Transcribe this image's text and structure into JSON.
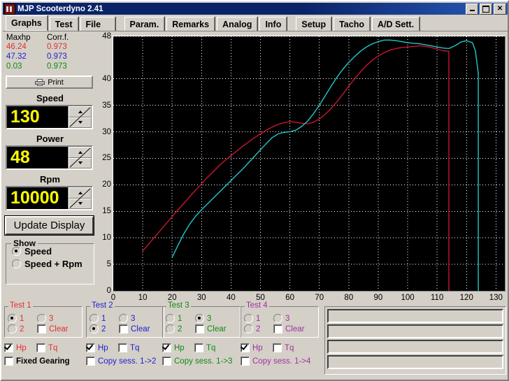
{
  "window": {
    "title": "MJP Scooterdyno 2.41",
    "icon": "app-icon",
    "buttons": {
      "minimize": "_",
      "maximize": "□",
      "close": "✕"
    }
  },
  "tabs": [
    {
      "label": "Graphs",
      "active": true
    },
    {
      "label": "Test",
      "active": false
    },
    {
      "label": "File",
      "active": false
    },
    {
      "label": "Param.",
      "active": false
    },
    {
      "label": "Remarks",
      "active": false
    },
    {
      "label": "Analog",
      "active": false
    },
    {
      "label": "Info",
      "active": false
    },
    {
      "label": "Setup",
      "active": false
    },
    {
      "label": "Tacho",
      "active": false
    },
    {
      "label": "A/D Sett.",
      "active": false
    }
  ],
  "results": {
    "header_maxhp": "Maxhp",
    "header_corrf": "Corr.f.",
    "rows": [
      {
        "maxhp": "46.24",
        "corrf": "0.973",
        "color": "#e03030"
      },
      {
        "maxhp": "47.32",
        "corrf": "0.973",
        "color": "#2020d0"
      },
      {
        "maxhp": "0.03",
        "corrf": "0.973",
        "color": "#108a10"
      }
    ]
  },
  "print_button": "Print",
  "fields": [
    {
      "label": "Speed",
      "value": "130"
    },
    {
      "label": "Power",
      "value": "48"
    },
    {
      "label": "Rpm",
      "value": "10000"
    }
  ],
  "update_button": "Update Display",
  "show_group": {
    "title": "Show",
    "options": [
      {
        "label": "Speed",
        "selected": true
      },
      {
        "label": "Speed + Rpm",
        "selected": false
      }
    ]
  },
  "tests": [
    {
      "title": "Test 1",
      "color": "#e03030",
      "radios": [
        {
          "label": "1",
          "selected": true
        },
        {
          "label": "3",
          "selected": false
        },
        {
          "label": "2",
          "selected": false
        }
      ],
      "clear": {
        "label": "Clear",
        "checked": false
      },
      "hp": {
        "label": "Hp",
        "checked": true
      },
      "tq": {
        "label": "Tq",
        "checked": false
      },
      "extra": {
        "label": "Fixed Gearing",
        "checked": false,
        "bold": true
      }
    },
    {
      "title": "Test 2",
      "color": "#2020d0",
      "radios": [
        {
          "label": "1",
          "selected": false
        },
        {
          "label": "3",
          "selected": false
        },
        {
          "label": "2",
          "selected": true
        }
      ],
      "clear": {
        "label": "Clear",
        "checked": false
      },
      "hp": {
        "label": "Hp",
        "checked": true
      },
      "tq": {
        "label": "Tq",
        "checked": false
      },
      "extra": {
        "label": "Copy sess. 1->2",
        "checked": false,
        "bold": false
      }
    },
    {
      "title": "Test 3",
      "color": "#108a10",
      "radios": [
        {
          "label": "1",
          "selected": false
        },
        {
          "label": "3",
          "selected": true
        },
        {
          "label": "2",
          "selected": false
        }
      ],
      "clear": {
        "label": "Clear",
        "checked": false
      },
      "hp": {
        "label": "Hp",
        "checked": true
      },
      "tq": {
        "label": "Tq",
        "checked": false
      },
      "extra": {
        "label": "Copy sess. 1->3",
        "checked": false,
        "bold": false
      }
    },
    {
      "title": "Test 4",
      "color": "#a030a0",
      "radios": [
        {
          "label": "1",
          "selected": false
        },
        {
          "label": "3",
          "selected": false
        },
        {
          "label": "2",
          "selected": false
        }
      ],
      "clear": {
        "label": "Clear",
        "checked": false
      },
      "hp": {
        "label": "Hp",
        "checked": true
      },
      "tq": {
        "label": "Tq",
        "checked": false
      },
      "extra": {
        "label": "Copy sess. 1->4",
        "checked": false,
        "bold": false
      }
    }
  ],
  "right_textboxes": [
    "",
    "",
    "",
    ""
  ],
  "chart_data": {
    "type": "line",
    "title": "",
    "xlabel": "",
    "ylabel": "",
    "xlim": [
      0,
      133
    ],
    "ylim": [
      0,
      48
    ],
    "xticks": [
      0,
      10,
      20,
      30,
      40,
      50,
      60,
      70,
      80,
      90,
      100,
      110,
      120,
      130
    ],
    "yticks": [
      0,
      5,
      10,
      15,
      20,
      25,
      30,
      35,
      40,
      48
    ],
    "grid": true,
    "background": "#000000",
    "legend": "none",
    "series": [
      {
        "name": "Test 1 Hp",
        "color": "#c81432",
        "x": [
          10,
          12,
          14,
          16,
          18,
          20,
          22,
          24,
          26,
          28,
          30,
          32,
          34,
          36,
          38,
          40,
          42,
          44,
          46,
          48,
          50,
          52,
          54,
          56,
          58,
          60,
          62,
          64,
          66,
          68,
          70,
          72,
          74,
          76,
          78,
          80,
          82,
          84,
          86,
          88,
          90,
          92,
          94,
          96,
          98,
          100,
          102,
          104,
          106,
          108,
          110,
          112,
          114,
          114
        ],
        "y": [
          7.5,
          8.8,
          10.1,
          11.4,
          12.7,
          14.0,
          15.3,
          16.5,
          17.8,
          19.0,
          20.2,
          21.4,
          22.5,
          23.6,
          24.6,
          25.5,
          26.4,
          27.3,
          28.1,
          28.9,
          29.6,
          30.3,
          30.9,
          31.4,
          31.7,
          31.9,
          31.8,
          31.6,
          31.5,
          31.8,
          32.4,
          33.3,
          34.4,
          35.7,
          37.1,
          38.6,
          40.0,
          41.3,
          42.5,
          43.5,
          44.3,
          44.9,
          45.4,
          45.7,
          45.9,
          46.0,
          46.1,
          46.2,
          46.1,
          45.9,
          45.6,
          45.3,
          45.2,
          0.0
        ]
      },
      {
        "name": "Test 2 Hp",
        "color": "#20c8c8",
        "x": [
          20,
          22,
          24,
          26,
          28,
          30,
          32,
          34,
          36,
          38,
          40,
          42,
          44,
          46,
          48,
          50,
          52,
          54,
          56,
          58,
          60,
          62,
          64,
          66,
          68,
          70,
          72,
          74,
          76,
          78,
          80,
          82,
          84,
          86,
          88,
          90,
          92,
          94,
          96,
          98,
          100,
          102,
          104,
          106,
          108,
          110,
          112,
          114,
          116,
          118,
          120,
          122,
          123,
          124,
          124
        ],
        "y": [
          6.3,
          8.6,
          10.8,
          12.6,
          14.1,
          15.3,
          16.4,
          17.5,
          18.6,
          19.7,
          20.8,
          21.9,
          23.0,
          24.2,
          25.4,
          26.6,
          27.8,
          28.9,
          29.6,
          29.9,
          30.0,
          30.3,
          31.0,
          32.0,
          33.4,
          35.0,
          36.8,
          38.6,
          40.3,
          41.8,
          43.1,
          44.2,
          45.2,
          46.0,
          46.6,
          47.0,
          47.3,
          47.3,
          47.2,
          47.0,
          46.8,
          46.7,
          46.6,
          46.4,
          46.2,
          46.0,
          45.8,
          45.7,
          46.2,
          46.9,
          47.2,
          46.8,
          45.3,
          41.0,
          0.0
        ]
      }
    ]
  }
}
